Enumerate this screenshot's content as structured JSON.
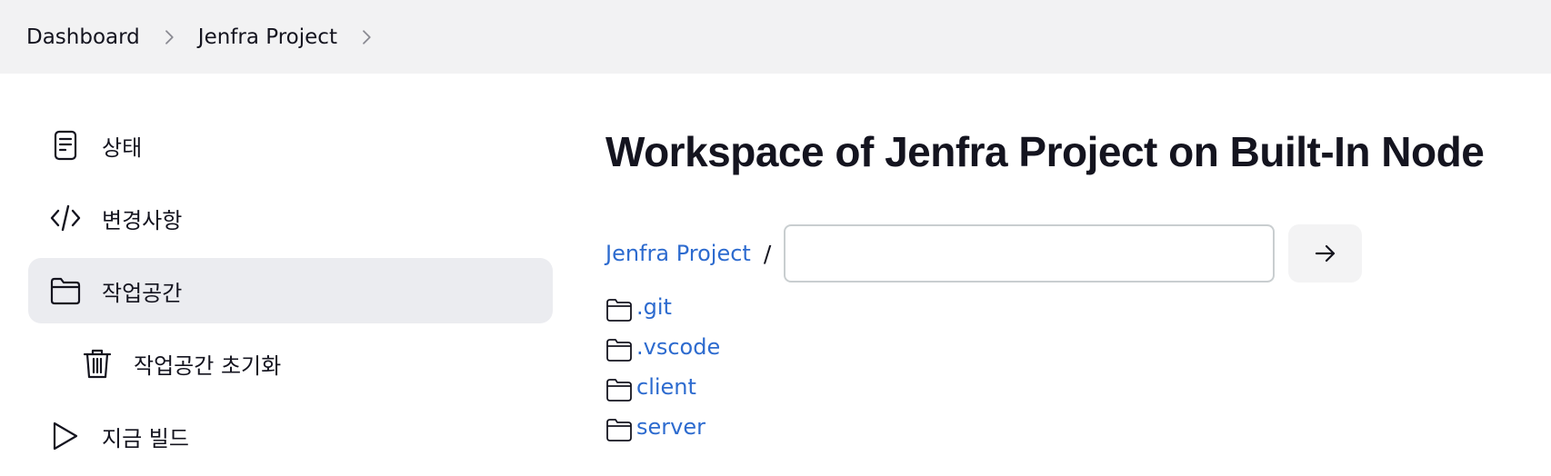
{
  "breadcrumb": {
    "items": [
      "Dashboard",
      "Jenfra Project"
    ]
  },
  "sidebar": {
    "items": [
      {
        "label": "상태",
        "icon": "document-icon"
      },
      {
        "label": "변경사항",
        "icon": "code-icon"
      },
      {
        "label": "작업공간",
        "icon": "folder-icon",
        "active": true
      },
      {
        "label": "작업공간 초기화",
        "icon": "trash-icon"
      },
      {
        "label": "지금 빌드",
        "icon": "play-icon"
      }
    ]
  },
  "main": {
    "title": "Workspace of Jenfra Project on Built-In Node",
    "path_root": "Jenfra Project",
    "path_separator": "/",
    "path_input_value": "",
    "files": [
      ".git",
      ".vscode",
      "client",
      "server"
    ]
  },
  "colors": {
    "link": "#2d6bcf",
    "breadcrumb_bg": "#f2f2f3",
    "active_bg": "#ebecf0"
  }
}
